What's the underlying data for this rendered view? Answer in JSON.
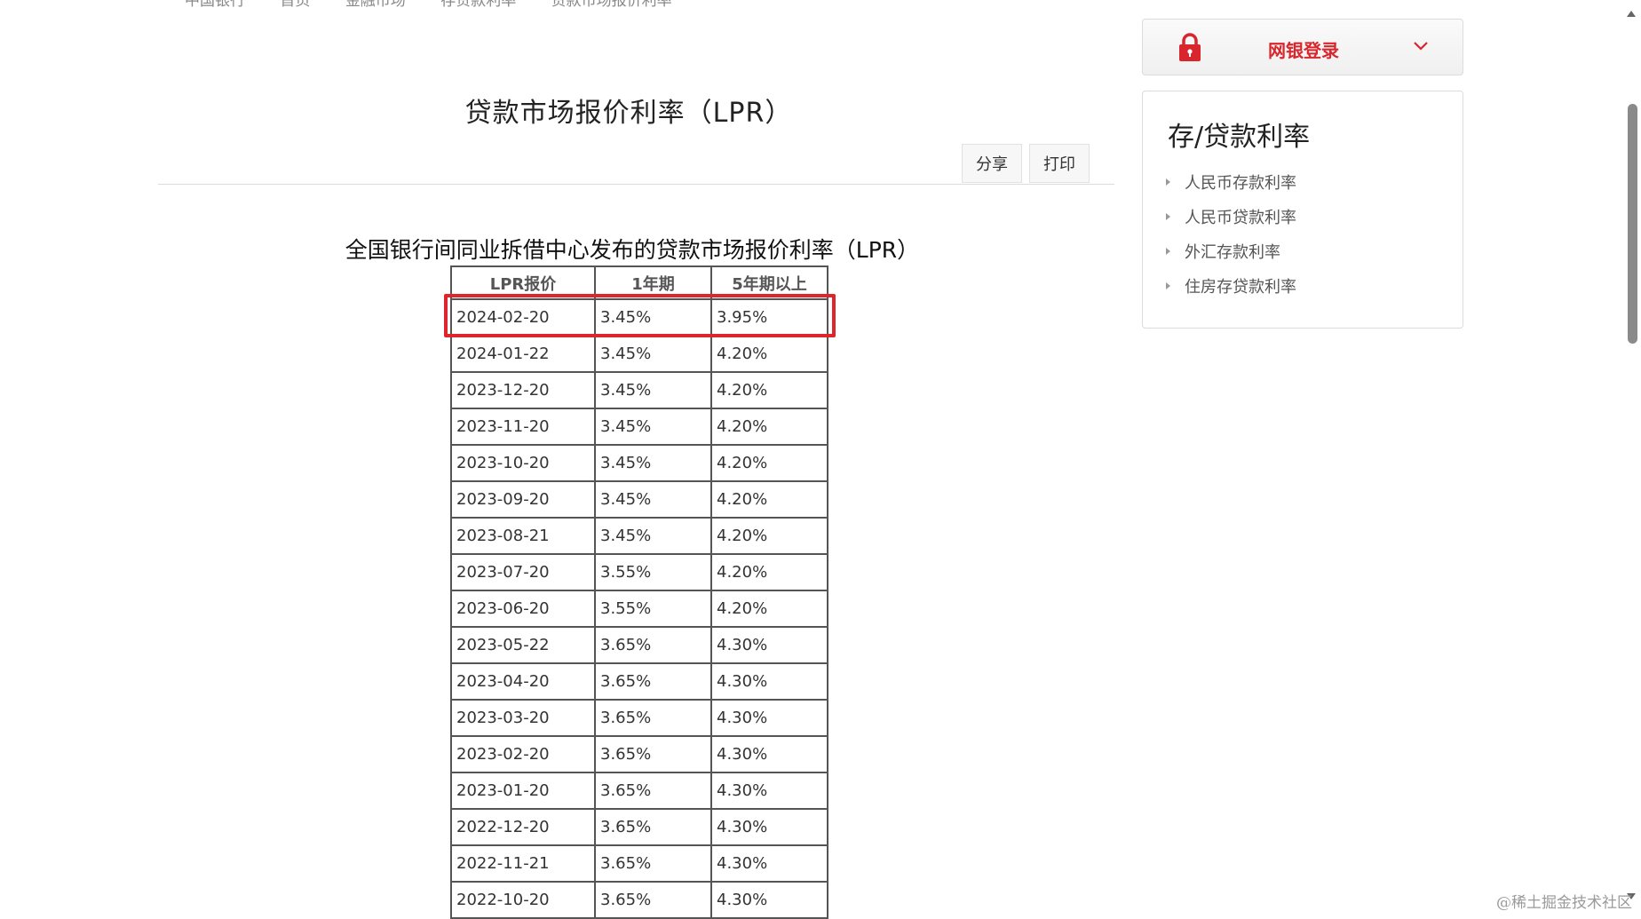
{
  "breadcrumb": [
    "中国银行",
    "首页",
    "金融市场",
    "存贷款利率",
    "贷款市场报价利率"
  ],
  "page_title": "贷款市场报价利率（LPR）",
  "actions": {
    "share": "分享",
    "print": "打印"
  },
  "table_title": "全国银行间同业拆借中心发布的贷款市场报价利率（LPR）",
  "table": {
    "headers": [
      "LPR报价",
      "1年期",
      "5年期以上"
    ],
    "rows": [
      [
        "2024-02-20",
        "3.45%",
        "3.95%"
      ],
      [
        "2024-01-22",
        "3.45%",
        "4.20%"
      ],
      [
        "2023-12-20",
        "3.45%",
        "4.20%"
      ],
      [
        "2023-11-20",
        "3.45%",
        "4.20%"
      ],
      [
        "2023-10-20",
        "3.45%",
        "4.20%"
      ],
      [
        "2023-09-20",
        "3.45%",
        "4.20%"
      ],
      [
        "2023-08-21",
        "3.45%",
        "4.20%"
      ],
      [
        "2023-07-20",
        "3.55%",
        "4.20%"
      ],
      [
        "2023-06-20",
        "3.55%",
        "4.20%"
      ],
      [
        "2023-05-22",
        "3.65%",
        "4.30%"
      ],
      [
        "2023-04-20",
        "3.65%",
        "4.30%"
      ],
      [
        "2023-03-20",
        "3.65%",
        "4.30%"
      ],
      [
        "2023-02-20",
        "3.65%",
        "4.30%"
      ],
      [
        "2023-01-20",
        "3.65%",
        "4.30%"
      ],
      [
        "2022-12-20",
        "3.65%",
        "4.30%"
      ],
      [
        "2022-11-21",
        "3.65%",
        "4.30%"
      ],
      [
        "2022-10-20",
        "3.65%",
        "4.30%"
      ]
    ],
    "highlighted_row": 0
  },
  "sidebar": {
    "login_label": "网银登录",
    "rates_title": "存/贷款利率",
    "rates_items": [
      "人民币存款利率",
      "人民币贷款利率",
      "外汇存款利率",
      "住房存贷款利率"
    ]
  },
  "watermark": "@稀土掘金技术社区",
  "colors": {
    "accent_red": "#d9252c",
    "highlight_border": "#e0242b"
  }
}
